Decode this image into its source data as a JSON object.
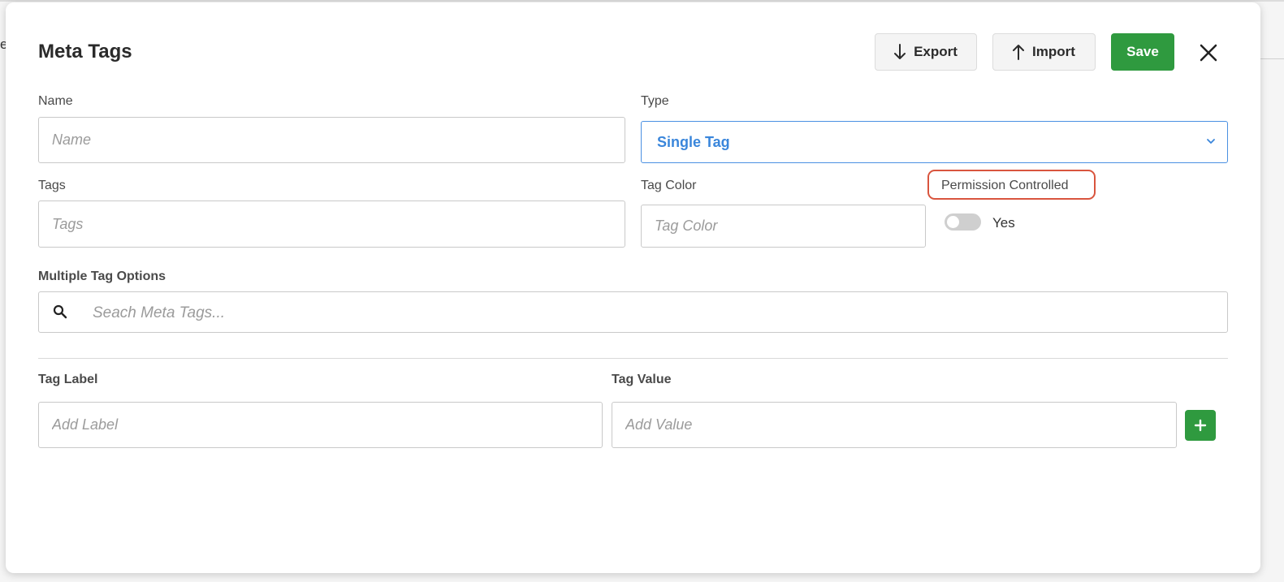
{
  "background": {
    "text": "e"
  },
  "modal": {
    "title": "Meta Tags",
    "buttons": {
      "export_label": "Export",
      "import_label": "Import",
      "save_label": "Save"
    },
    "icons": {
      "export": "arrow-down-icon",
      "import": "arrow-up-icon",
      "close": "close-icon",
      "search": "search-icon",
      "add": "plus-icon",
      "select": "chevron-down-icon"
    }
  },
  "form": {
    "name": {
      "label": "Name",
      "placeholder": "Name",
      "value": ""
    },
    "type": {
      "label": "Type",
      "value": "Single Tag"
    },
    "tags": {
      "label": "Tags",
      "placeholder": "Tags",
      "value": ""
    },
    "tag_color": {
      "label": "Tag Color",
      "placeholder": "Tag Color",
      "value": ""
    },
    "permission": {
      "label": "Permission Controlled",
      "toggle_label": "Yes",
      "enabled": false
    },
    "multiple_options": {
      "label": "Multiple Tag Options",
      "placeholder": "Seach Meta Tags..."
    },
    "tag_label": {
      "label": "Tag Label",
      "placeholder": "Add Label"
    },
    "tag_value": {
      "label": "Tag Value",
      "placeholder": "Add Value"
    }
  },
  "colors": {
    "primary_green": "#2f9a3f",
    "select_blue": "#3a86db",
    "highlight_red": "#d9553e"
  }
}
